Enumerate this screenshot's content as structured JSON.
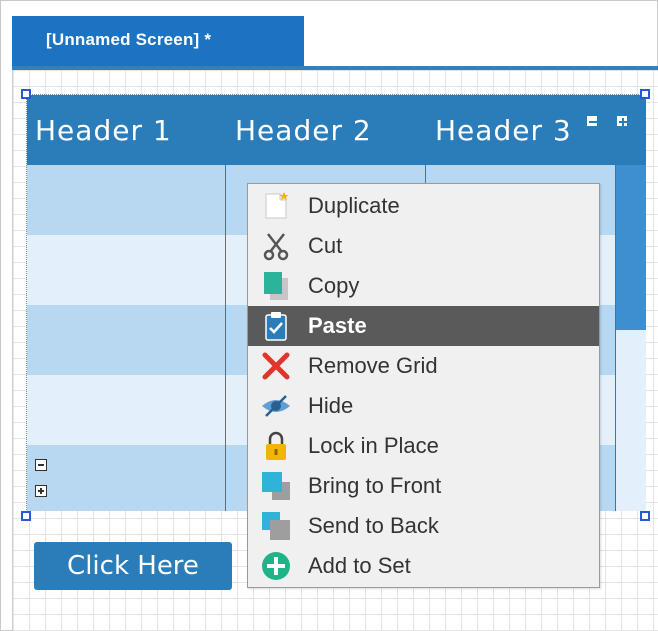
{
  "tab": {
    "title": "[Unnamed Screen] *"
  },
  "grid": {
    "headers": [
      "Header 1",
      "Header 2",
      "Header 3"
    ]
  },
  "button": {
    "label": "Click Here"
  },
  "context_menu": {
    "items": [
      {
        "label": "Duplicate",
        "icon": "duplicate-icon"
      },
      {
        "label": "Cut",
        "icon": "scissors-icon"
      },
      {
        "label": "Copy",
        "icon": "copy-icon"
      },
      {
        "label": "Paste",
        "icon": "clipboard-icon",
        "highlighted": true
      },
      {
        "label": "Remove Grid",
        "icon": "red-x-icon"
      },
      {
        "label": "Hide",
        "icon": "eye-slash-icon"
      },
      {
        "label": "Lock in Place",
        "icon": "lock-icon"
      },
      {
        "label": "Bring to Front",
        "icon": "bring-front-icon"
      },
      {
        "label": "Send to Back",
        "icon": "send-back-icon"
      },
      {
        "label": "Add to Set",
        "icon": "plus-circle-icon"
      }
    ]
  },
  "colors": {
    "accent": "#2a7db8",
    "tab": "#1b73c2",
    "row_dark": "#b8d8f2",
    "row_light": "#e3f0fb",
    "highlight": "#5a5a5a"
  }
}
